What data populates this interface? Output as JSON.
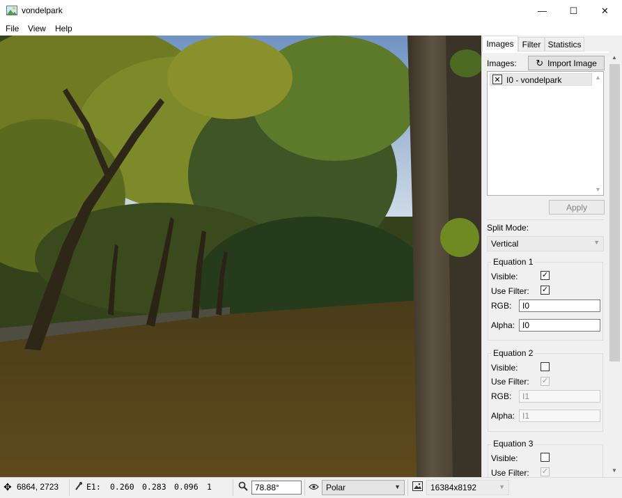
{
  "window": {
    "title": "vondelpark",
    "controls": {
      "minimize": "—",
      "maximize": "☐",
      "close": "✕"
    }
  },
  "menu": {
    "items": [
      "File",
      "View",
      "Help"
    ]
  },
  "tabs": [
    {
      "label": "Images",
      "active": true
    },
    {
      "label": "Filter",
      "active": false
    },
    {
      "label": "Statistics",
      "active": false
    }
  ],
  "images_panel": {
    "label": "Images:",
    "import_button": "Import Image",
    "list": [
      {
        "name": "I0 - vondelpark"
      }
    ],
    "apply_button": "Apply"
  },
  "split_mode": {
    "label": "Split Mode:",
    "value": "Vertical"
  },
  "equations": [
    {
      "title": "Equation 1",
      "visible_label": "Visible:",
      "visible": true,
      "filter_label": "Use Filter:",
      "use_filter": true,
      "rgb_label": "RGB:",
      "rgb": "I0",
      "alpha_label": "Alpha:",
      "alpha": "I0",
      "enabled": true
    },
    {
      "title": "Equation 2",
      "visible_label": "Visible:",
      "visible": false,
      "filter_label": "Use Filter:",
      "use_filter": true,
      "rgb_label": "RGB:",
      "rgb": "I1",
      "alpha_label": "Alpha:",
      "alpha": "I1",
      "enabled": false
    },
    {
      "title": "Equation 3",
      "visible_label": "Visible:",
      "visible": false,
      "filter_label": "Use Filter:",
      "use_filter": true,
      "enabled": false
    }
  ],
  "statusbar": {
    "cursor_pos": "6864, 2723",
    "pixel_label": "E1:",
    "pixel_r": "0.260",
    "pixel_g": "0.283",
    "pixel_b": "0.096",
    "pixel_a": "1",
    "zoom": "78.88°",
    "projection": "Polar",
    "resolution": "16384x8192"
  },
  "icons": {
    "app": "image-icon",
    "move": "move-icon",
    "picker": "eyedropper-icon",
    "zoom": "magnifier-icon",
    "eye": "eye-icon",
    "resolution": "image-size-icon",
    "remove": "remove-x-icon",
    "import": "refresh-icon"
  }
}
